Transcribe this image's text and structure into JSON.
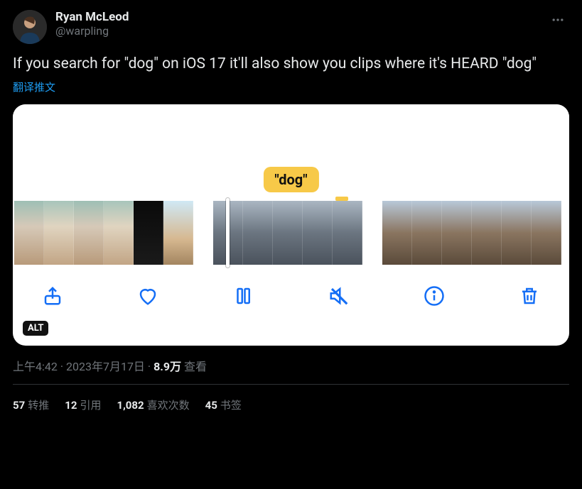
{
  "author": {
    "display_name": "Ryan McLeod",
    "handle": "@warpling"
  },
  "tweet_text": "If you search for \"dog\" on iOS 17 it'll also show you clips where it's HEARD \"dog\"",
  "translate_label": "翻译推文",
  "media": {
    "caption_bubble": "\"dog\"",
    "alt_badge": "ALT"
  },
  "meta": {
    "time": "上午4:42",
    "sep1": " · ",
    "date": "2023年7月17日",
    "sep2": " · ",
    "views_count": "8.9万",
    "views_label": " 查看"
  },
  "stats": {
    "retweets_count": "57",
    "retweets_label": "转推",
    "quotes_count": "12",
    "quotes_label": "引用",
    "likes_count": "1,082",
    "likes_label": "喜欢次数",
    "bookmarks_count": "45",
    "bookmarks_label": "书签"
  }
}
